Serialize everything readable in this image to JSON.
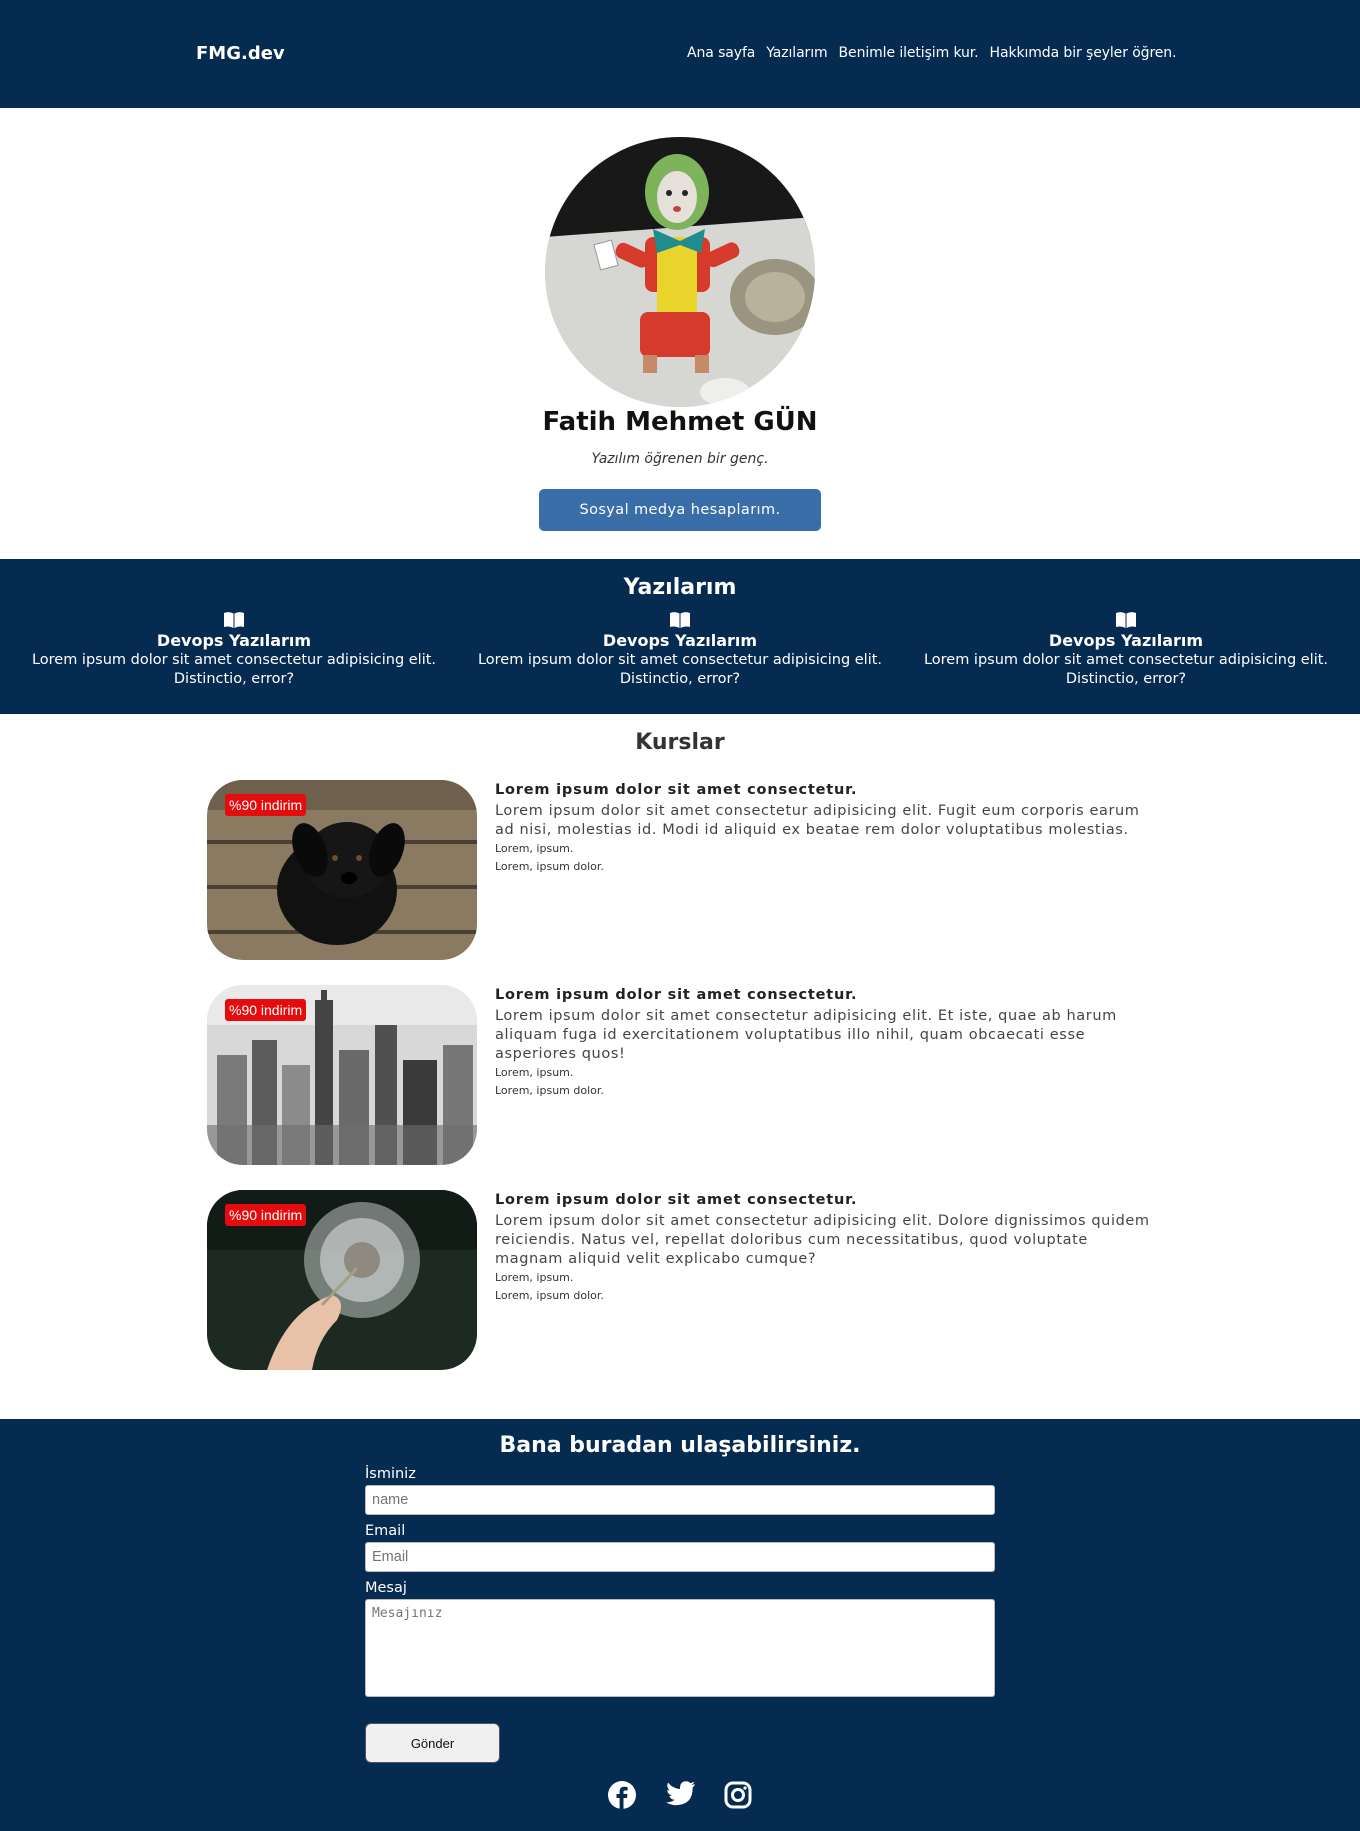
{
  "nav": {
    "brand": "FMG.dev",
    "links": [
      "Ana sayfa",
      "Yazılarım",
      "Benimle iletişim kur.",
      "Hakkımda bir şeyler öğren."
    ]
  },
  "hero": {
    "name": "Fatih Mehmet GÜN",
    "subtitle": "Yazılım öğrenen bir genç.",
    "social_button": "Sosyal medya hesaplarım."
  },
  "posts": {
    "title": "Yazılarım",
    "items": [
      {
        "icon": "book-open-icon",
        "title": "Devops Yazılarım",
        "text": "Lorem ipsum dolor sit amet consectetur adipisicing elit. Distinctio, error?"
      },
      {
        "icon": "book-open-icon",
        "title": "Devops Yazılarım",
        "text": "Lorem ipsum dolor sit amet consectetur adipisicing elit. Distinctio, error?"
      },
      {
        "icon": "book-open-icon",
        "title": "Devops Yazılarım",
        "text": "Lorem ipsum dolor sit amet consectetur adipisicing elit. Distinctio, error?"
      }
    ]
  },
  "courses": {
    "title": "Kurslar",
    "items": [
      {
        "badge": "%90 indirim",
        "image": "black-puppy-photo",
        "title": "Lorem ipsum dolor sit amet consectetur.",
        "desc": "Lorem ipsum dolor sit amet consectetur adipisicing elit. Fugit eum corporis earum ad nisi, molestias id. Modi id aliquid ex beatae rem dolor voluptatibus molestias.",
        "line1": "Lorem, ipsum.",
        "line2": "Lorem, ipsum dolor."
      },
      {
        "badge": "%90 indirim",
        "image": "city-skyline-photo",
        "title": "Lorem ipsum dolor sit amet consectetur.",
        "desc": "Lorem ipsum dolor sit amet consectetur adipisicing elit. Et iste, quae ab harum aliquam fuga id exercitationem voluptatibus illo nihil, quam obcaecati esse asperiores quos!",
        "line1": "Lorem, ipsum.",
        "line2": "Lorem, ipsum dolor."
      },
      {
        "badge": "%90 indirim",
        "image": "dandelion-photo",
        "title": "Lorem ipsum dolor sit amet consectetur.",
        "desc": "Lorem ipsum dolor sit amet consectetur adipisicing elit. Dolore dignissimos quidem reiciendis. Natus vel, repellat doloribus cum necessitatibus, quod voluptate magnam aliquid velit explicabo cumque?",
        "line1": "Lorem, ipsum.",
        "line2": "Lorem, ipsum dolor."
      }
    ]
  },
  "contact": {
    "title": "Bana buradan ulaşabilirsiniz.",
    "name_label": "İsminiz",
    "name_placeholder": "name",
    "email_label": "Email",
    "email_placeholder": "Email",
    "message_label": "Mesaj",
    "message_placeholder": "Mesajınız",
    "submit": "Gönder",
    "social": [
      "facebook-icon",
      "twitter-icon",
      "instagram-icon"
    ]
  },
  "colors": {
    "primary_dark": "#062b51",
    "button_blue": "#3a6ea8",
    "badge_red": "#e40c0c"
  }
}
